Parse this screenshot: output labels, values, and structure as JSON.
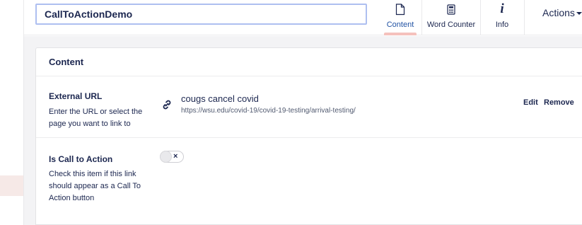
{
  "header": {
    "name_value": "CallToActionDemo",
    "apps": [
      {
        "label": "Content",
        "icon": "document-icon",
        "active": true
      },
      {
        "label": "Word Counter",
        "icon": "calculator-icon",
        "active": false
      },
      {
        "label": "Info",
        "icon": "info-icon",
        "active": false
      }
    ],
    "actions_label": "Actions"
  },
  "panel": {
    "title": "Content",
    "external_url": {
      "label": "External URL",
      "description": "Enter the URL or select the page you want to link to",
      "link_title": "cougs cancel covid",
      "link_url": "https://wsu.edu/covid-19/covid-19-testing/arrival-testing/",
      "edit_label": "Edit",
      "remove_label": "Remove"
    },
    "call_to_action": {
      "label": "Is Call to Action",
      "description": "Check this item if this link should appear as a Call To Action button",
      "toggle_state": false,
      "toggle_mark": "×"
    }
  },
  "colors": {
    "text": "#1b264f",
    "active_tab_bar": "#f5c1bc",
    "input_border": "#aebff0",
    "background_grey": "#f3f3f5"
  }
}
